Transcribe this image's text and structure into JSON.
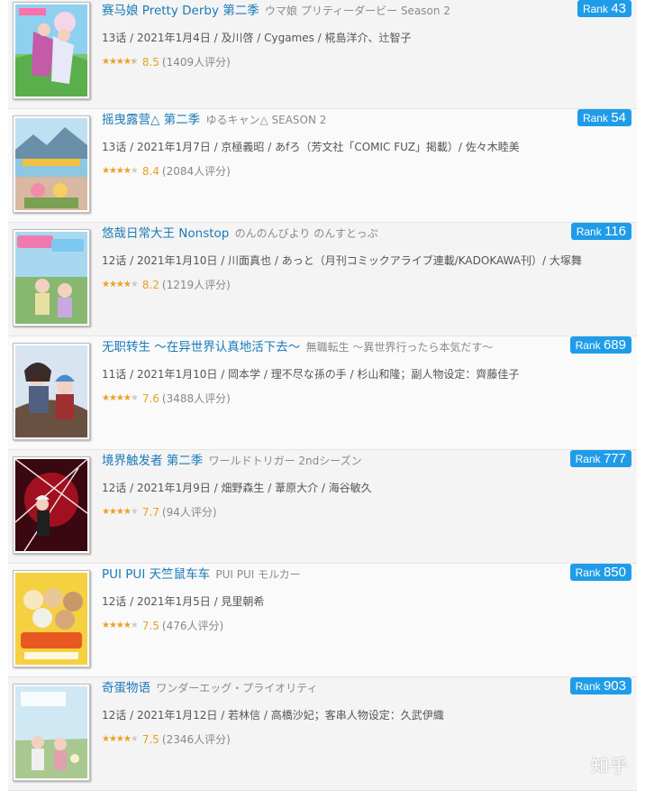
{
  "items": [
    {
      "title": "赛马娘 Pretty Derby 第二季",
      "title_jp": "ウマ娘 プリティーダービー Season 2",
      "rank_label": "Rank",
      "rank": "43",
      "info": "13话 / 2021年1月4日 / 及川啓 / Cygames / 椛島洋介、辻智子",
      "score": "8.5",
      "votes": "(1409人评分)",
      "stars_fraction": 0.9
    },
    {
      "title": "摇曳露营△ 第二季",
      "title_jp": "ゆるキャン△ SEASON 2",
      "rank_label": "Rank",
      "rank": "54",
      "info": "13话 / 2021年1月7日 / 京極義昭 / あfろ（芳文社「COMIC FUZ」掲載）/ 佐々木睦美",
      "score": "8.4",
      "votes": "(2084人评分)",
      "stars_fraction": 0.8
    },
    {
      "title": "悠哉日常大王 Nonstop",
      "title_jp": "のんのんびより のんすとっぷ",
      "rank_label": "Rank",
      "rank": "116",
      "info": "12话 / 2021年1月10日 / 川面真也 / あっと（月刊コミックアライブ連載/KADOKAWA刊）/ 大塚舞",
      "score": "8.2",
      "votes": "(1219人评分)",
      "stars_fraction": 0.8
    },
    {
      "title": "无职转生 ～在异世界认真地活下去～",
      "title_jp": "無職転生 ～異世界行ったら本気だす～",
      "rank_label": "Rank",
      "rank": "689",
      "info": "11话 / 2021年1月10日 / 岡本学 / 理不尽な孫の手 / 杉山和隆；副人物设定：齊藤佳子",
      "score": "7.6",
      "votes": "(3488人评分)",
      "stars_fraction": 0.8
    },
    {
      "title": "境界触发者 第二季",
      "title_jp": "ワールドトリガー 2ndシーズン",
      "rank_label": "Rank",
      "rank": "777",
      "info": "12话 / 2021年1月9日 / 畑野森生 / 葦原大介 / 海谷敏久",
      "score": "7.7",
      "votes": "(94人评分)",
      "stars_fraction": 0.8
    },
    {
      "title": "PUI PUI 天竺鼠车车",
      "title_jp": "PUI PUI モルカー",
      "rank_label": "Rank",
      "rank": "850",
      "info": "12话 / 2021年1月5日 / 見里朝希",
      "score": "7.5",
      "votes": "(476人评分)",
      "stars_fraction": 0.8
    },
    {
      "title": "奇蛋物语",
      "title_jp": "ワンダーエッグ・プライオリティ",
      "rank_label": "Rank",
      "rank": "903",
      "info": "12话 / 2021年1月12日 / 若林信 / 高橋沙妃；客串人物设定：久武伊織",
      "score": "7.5",
      "votes": "(2346人评分)",
      "stars_fraction": 0.8
    }
  ],
  "stars_glyphs": "★★★★★",
  "watermark": "知乎",
  "colors": {
    "title_link": "#1a7ab8",
    "rank_badge": "#1f9ce8",
    "star": "#f0a020",
    "score": "#e8a020"
  }
}
